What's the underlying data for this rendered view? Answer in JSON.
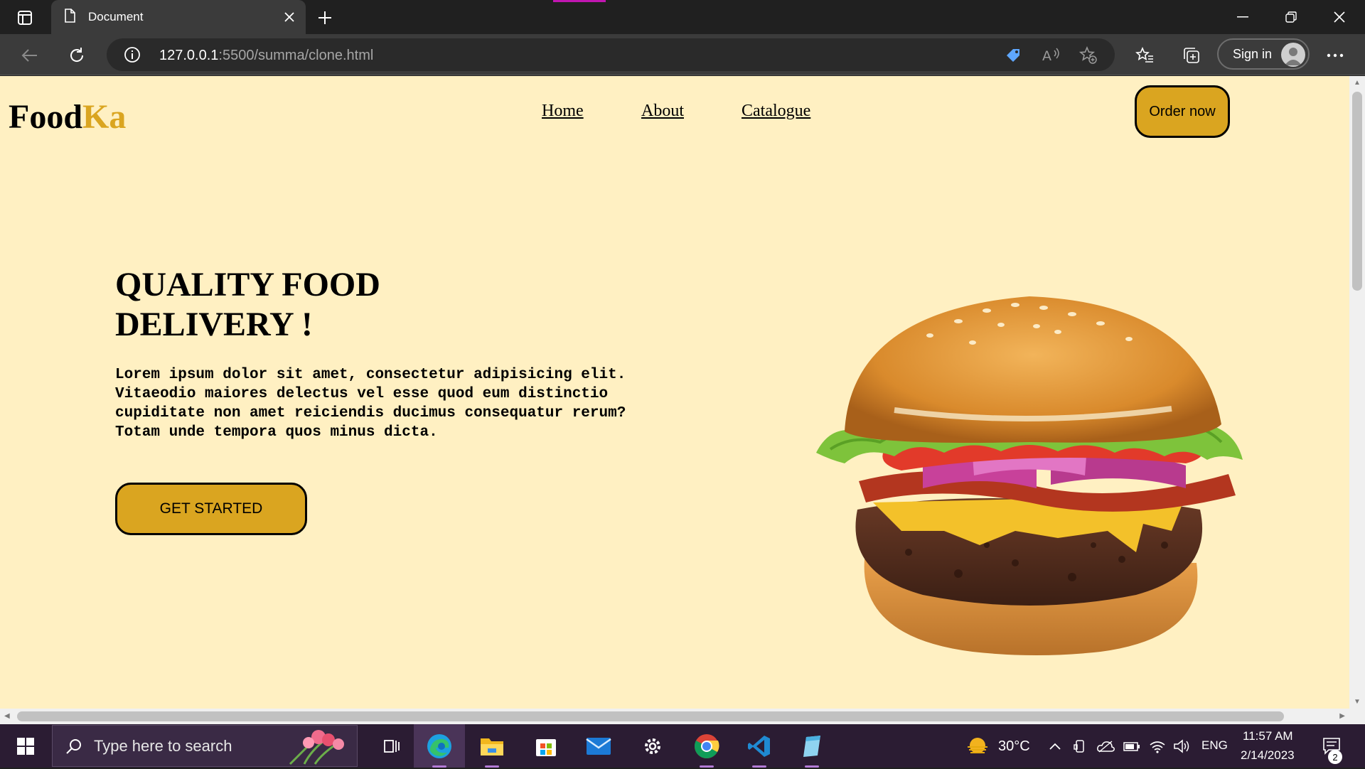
{
  "browser": {
    "tab": {
      "title": "Document"
    },
    "address": {
      "host": "127.0.0.1",
      "path": ":5500/summa/clone.html"
    },
    "signin_label": "Sign in"
  },
  "site": {
    "logo": {
      "part1": "Food",
      "part2": "Ka"
    },
    "nav": [
      "Home",
      "About",
      "Catalogue"
    ],
    "order_button": "Order now",
    "hero": {
      "title_line1": "QUALITY FOOD",
      "title_line2": "DELIVERY !",
      "body_line1": "Lorem ipsum dolor sit amet, consectetur adipisicing elit.",
      "body_line2": "Vitaeodio maiores delectus vel esse quod eum distinctio",
      "body_line3": "cupiditate non amet reiciendis ducimus consequatur rerum?",
      "body_line4": "Totam unde tempora quos minus dicta.",
      "cta": "GET STARTED"
    },
    "colors": {
      "background": "#fff0c2",
      "accent": "#daa520"
    }
  },
  "taskbar": {
    "search_placeholder": "Type here to search",
    "weather": "30°C",
    "language": "ENG",
    "time": "11:57 AM",
    "date": "2/14/2023",
    "notification_count": "2"
  }
}
